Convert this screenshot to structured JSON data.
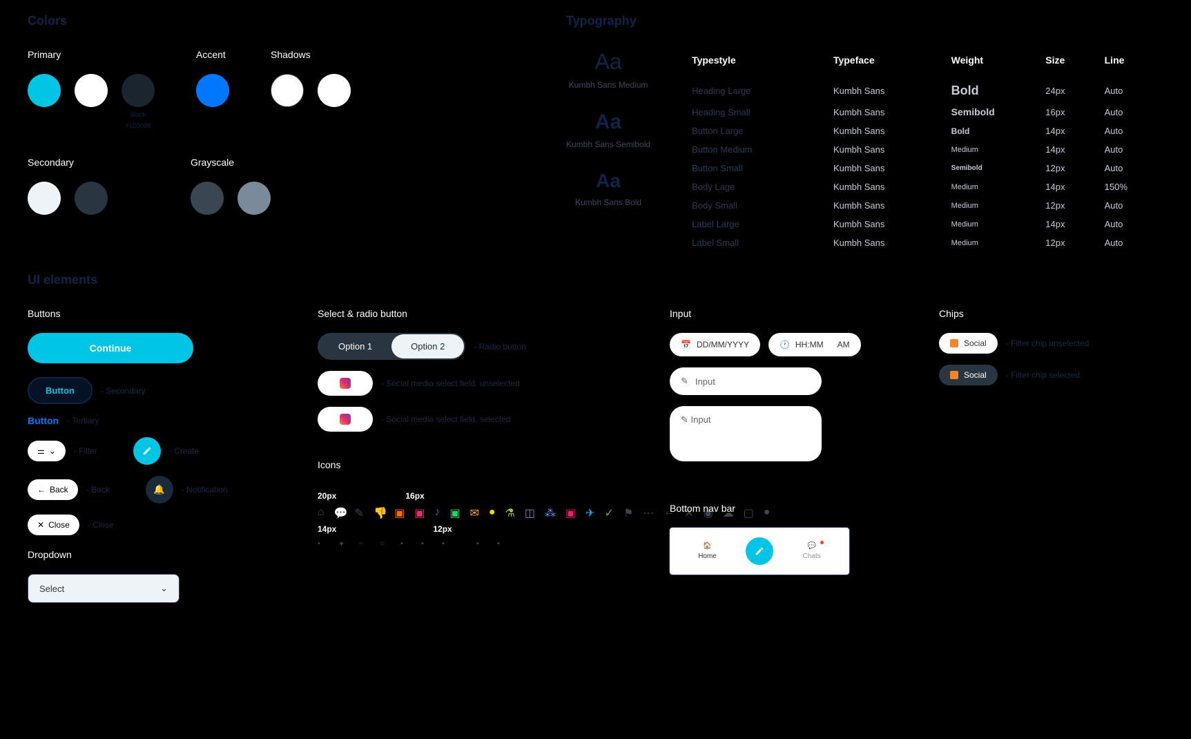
{
  "sections": {
    "colors": "Colors",
    "typography": "Typography",
    "ui": "UI elements"
  },
  "colors": {
    "primary_label": "Primary",
    "accent_label": "Accent",
    "shadows_label": "Shadows",
    "secondary_label": "Secondary",
    "grayscale_label": "Grayscale",
    "primary": [
      {
        "hex": "#00c5e5"
      },
      {
        "hex": "#ffffff"
      },
      {
        "hex": "#1a2530",
        "name": "Black",
        "code": "#1D3008"
      }
    ],
    "accent": [
      {
        "hex": "#0077ff"
      }
    ],
    "shadows": [
      {
        "hex": "#ffffff",
        "border": "#ccc"
      },
      {
        "hex": "#ffffff"
      }
    ],
    "secondary": [
      {
        "hex": "#eef3f8"
      },
      {
        "hex": "#2a3542"
      }
    ],
    "grayscale": [
      {
        "hex": "#3a4652"
      },
      {
        "hex": "#7a8a9a"
      }
    ]
  },
  "typography": {
    "samples": [
      {
        "label": "Kumbh Sans Medium",
        "size": "32px",
        "weight": "500"
      },
      {
        "label": "Kumbh Sans Semibold",
        "size": "30px",
        "weight": "600"
      },
      {
        "label": "Kumbh Sans Bold",
        "size": "28px",
        "weight": "700"
      }
    ],
    "headers": {
      "c1": "Typestyle",
      "c2": "Typeface",
      "c3": "Weight",
      "c4": "Size",
      "c5": "Line"
    },
    "rows": [
      {
        "style": "Heading Large",
        "face": "Kumbh Sans",
        "weight": "Bold",
        "wsize": "18px",
        "wweight": "700",
        "size": "24px",
        "line": "Auto"
      },
      {
        "style": "Heading Small",
        "face": "Kumbh Sans",
        "weight": "Semibold",
        "wsize": "14px",
        "wweight": "600",
        "size": "16px",
        "line": "Auto"
      },
      {
        "style": "Button Large",
        "face": "Kumbh Sans",
        "weight": "Bold",
        "wsize": "12px",
        "wweight": "700",
        "size": "14px",
        "line": "Auto"
      },
      {
        "style": "Button Medium",
        "face": "Kumbh Sans",
        "weight": "Medium",
        "wsize": "11px",
        "wweight": "500",
        "size": "14px",
        "line": "Auto"
      },
      {
        "style": "Button Small",
        "face": "Kumbh Sans",
        "weight": "Semibold",
        "wsize": "10px",
        "wweight": "600",
        "size": "12px",
        "line": "Auto"
      },
      {
        "style": "Body Lage",
        "face": "Kumbh Sans",
        "weight": "Medium",
        "wsize": "11px",
        "wweight": "500",
        "size": "14px",
        "line": "150%"
      },
      {
        "style": "Body Small",
        "face": "Kumbh Sans",
        "weight": "Medium",
        "wsize": "11px",
        "wweight": "500",
        "size": "12px",
        "line": "Auto"
      },
      {
        "style": "Label Large",
        "face": "Kumbh Sans",
        "weight": "Medium",
        "wsize": "11px",
        "wweight": "500",
        "size": "14px",
        "line": "Auto"
      },
      {
        "style": "Label Small",
        "face": "Kumbh Sans",
        "weight": "Medium",
        "wsize": "11px",
        "wweight": "500",
        "size": "12px",
        "line": "Auto"
      }
    ]
  },
  "ui": {
    "buttons_label": "Buttons",
    "select_label": "Select & radio button",
    "input_label": "Input",
    "chips_label": "Chips",
    "dropdown_label": "Dropdown",
    "icons_label": "Icons",
    "nav_label": "Bottom nav bar",
    "continue": "Continue",
    "secondary_btn": "Button",
    "secondary_desc": "- Secondary",
    "tertiary_btn": "Button",
    "tertiary_desc": "- Tertiary",
    "filter_desc": "- Filter",
    "create_desc": "- Create",
    "back_btn": "Back",
    "back_desc": "- Back",
    "notif_desc": "- Notification",
    "close_btn": "Close",
    "close_desc": "- Close",
    "option1": "Option 1",
    "option2": "Option 2",
    "radio_desc": "- Radio button",
    "social_unsel_desc": "- Social media select field, unselected",
    "social_sel_desc": "- Social media select field, selected",
    "date_ph": "DD/MM/YYYY",
    "time_ph": "HH:MM",
    "ampm": "AM",
    "input_ph": "Input",
    "chip_social": "Social",
    "chip_unsel_desc": "- Filter chip unselected",
    "chip_sel_desc": "- Filter chip selected",
    "dropdown_ph": "Select",
    "size20": "20px",
    "size16": "16px",
    "size14": "14px",
    "size12": "12px",
    "nav_home": "Home",
    "nav_chats": "Chats"
  }
}
